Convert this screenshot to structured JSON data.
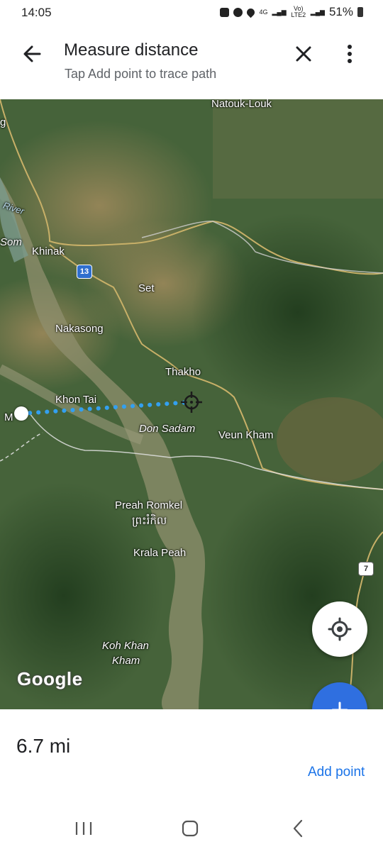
{
  "status": {
    "time": "14:05",
    "network": "4G",
    "lte": "Vo) LTE2",
    "battery": "51%"
  },
  "header": {
    "title": "Measure distance",
    "subtitle": "Tap Add point to trace path"
  },
  "map": {
    "labels": {
      "natouk_louk": "Natouk-Louk",
      "g": "g",
      "river": "River",
      "som": "Som",
      "khinak": "Khinak",
      "set": "Set",
      "nakasong": "Nakasong",
      "thakho": "Thakho",
      "khon_tai": "Khon Tai",
      "m": "M",
      "don_sadam": "Don Sadam",
      "veun_kham": "Veun Kham",
      "preah_romkel": "Preah Romkel",
      "preah_romkel_khmer": "ព្រះរំកិល",
      "krala_peah": "Krala Peah",
      "koh_khan_1": "Koh Khan",
      "koh_khan_2": "Kham"
    },
    "road_shields": {
      "route_13": "13",
      "route_7": "7"
    },
    "logo": "Google"
  },
  "measurement": {
    "distance": "6.7 mi",
    "add_point_label": "Add point"
  },
  "icons": {
    "back": "back-arrow-icon",
    "close": "close-icon",
    "more": "more-vert-icon",
    "locate": "my-location-icon",
    "add": "plus-icon",
    "crosshair": "crosshair-icon",
    "nav_recents": "recents-icon",
    "nav_home": "home-icon",
    "nav_back": "back-icon"
  },
  "colors": {
    "accent": "#1a73e8",
    "fab": "#2f6fe0",
    "path": "#33a0f0"
  }
}
